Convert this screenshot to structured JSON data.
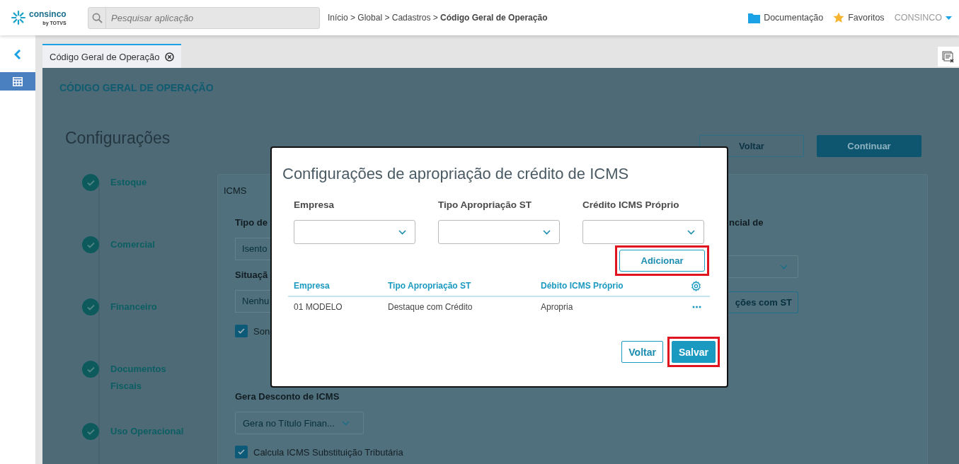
{
  "header": {
    "logo": {
      "name": "consinco",
      "byline": "by",
      "sub": "TOTVS"
    },
    "search": {
      "placeholder": "Pesquisar aplicação"
    },
    "breadcrumb": "Início > Global > Cadastros > **Código Geral de Operação**",
    "links": [
      {
        "kind": "folder",
        "label": "Documentação"
      },
      {
        "kind": "star",
        "label": "Favoritos"
      }
    ],
    "user": "CONSINCO"
  },
  "sidebar": {
    "items": [
      {
        "kind": "collapse",
        "selected": false
      },
      {
        "kind": "calendar",
        "selected": true
      }
    ]
  },
  "tabs": [
    {
      "label": "Código Geral de Operação",
      "selected": true
    }
  ],
  "page": {
    "heading": "CÓDIGO GERAL DE OPERAÇÃO",
    "title": "Configurações",
    "buttons": [
      {
        "label": "Voltar",
        "kind": "outline"
      },
      {
        "label": "Continuar",
        "kind": "primary"
      }
    ],
    "steps": [
      {
        "label": "Estoque",
        "done": true
      },
      {
        "label": "Comercial",
        "done": true
      },
      {
        "label": "Financeiro",
        "done": true
      },
      {
        "label": "Documentos Fiscais",
        "done": true
      },
      {
        "label": "Uso Operacional",
        "done": true
      }
    ],
    "panel": {
      "title": "ICMS",
      "left": [
        {
          "kind": "label",
          "text": "Tipo de"
        },
        {
          "kind": "select",
          "text": "Isento"
        },
        {
          "kind": "label",
          "text": "Situaçã"
        },
        {
          "kind": "select",
          "text": "Nenhu"
        },
        {
          "kind": "checkbox",
          "text": "Son",
          "checked": true
        }
      ],
      "right": [
        {
          "kind": "label",
          "text": "ncial de"
        },
        {
          "kind": "dropdown"
        },
        {
          "kind": "button",
          "text": "ções com ST"
        }
      ],
      "bottom": [
        {
          "kind": "label",
          "text": "Gera Desconto de ICMS"
        },
        {
          "kind": "dropdown",
          "text": "Gera no Título Finan..."
        },
        {
          "kind": "checkbox",
          "text": "Calcula ICMS Substituição Tributária",
          "checked": true
        }
      ]
    }
  },
  "modal": {
    "title": "Configurações de apropriação de crédito de ICMS",
    "filters": [
      {
        "label": "Empresa"
      },
      {
        "label": "Tipo Apropriação ST"
      },
      {
        "label": "Crédito ICMS Próprio"
      }
    ],
    "add_button": {
      "label": "Adicionar",
      "highlighted": true
    },
    "table": {
      "columns": [
        "Empresa",
        "Tipo Apropriação ST",
        "Débito ICMS Próprio"
      ],
      "rows": [
        {
          "cells": [
            "01 MODELO",
            "Destaque com Crédito",
            "Apropria"
          ]
        }
      ]
    },
    "buttons": [
      {
        "label": "Voltar",
        "kind": "outline",
        "highlighted": false
      },
      {
        "label": "Salvar",
        "kind": "primary",
        "highlighted": true
      }
    ]
  }
}
